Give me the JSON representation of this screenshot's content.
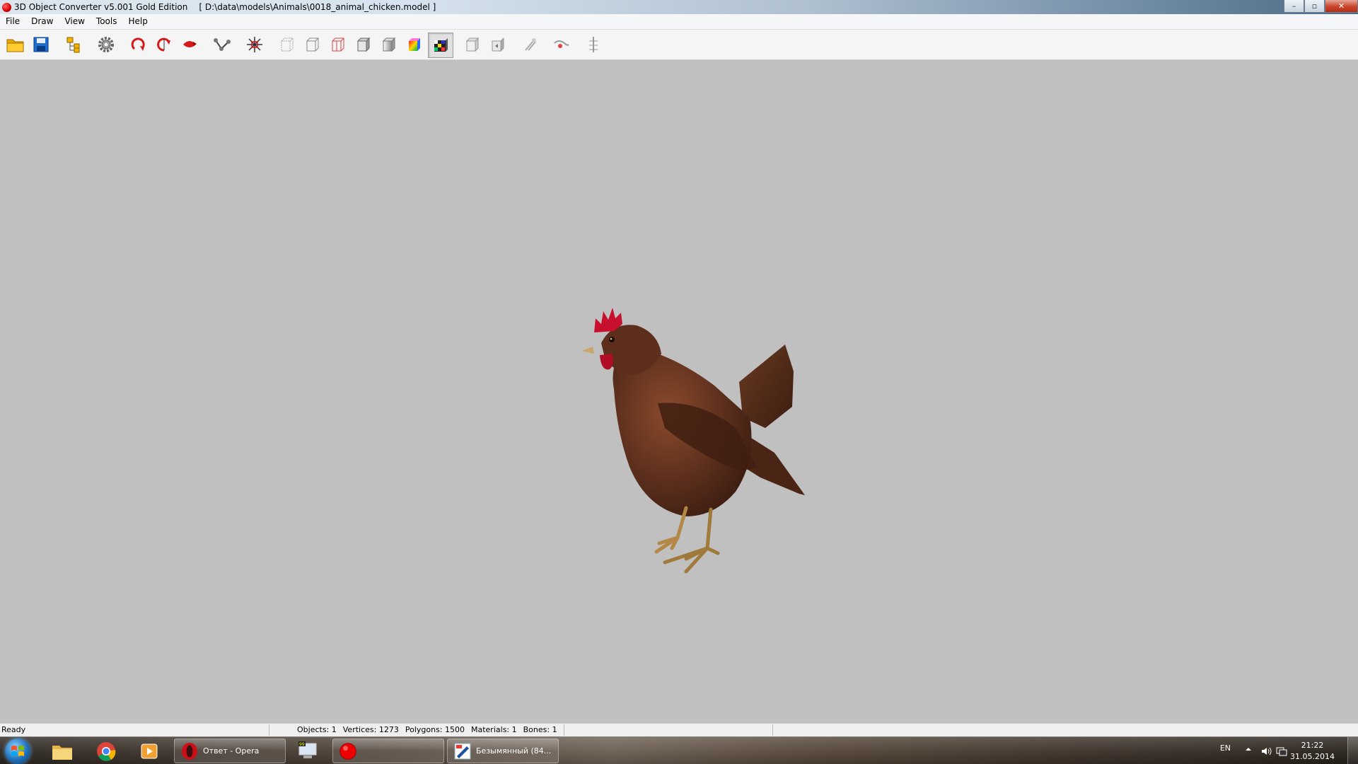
{
  "window": {
    "app_title": "3D Object Converter v5.001 Gold Edition",
    "file_path": "[ D:\\data\\models\\Animals\\0018_animal_chicken.model ]",
    "minimize_symbol": "–",
    "maximize_symbol": "▫",
    "close_symbol": "✕"
  },
  "menu": {
    "items": [
      "File",
      "Draw",
      "View",
      "Tools",
      "Help"
    ]
  },
  "toolbar": {
    "buttons": [
      {
        "icon": "open-folder-icon"
      },
      {
        "icon": "save-disk-icon"
      },
      {
        "icon": "object-tree-icon"
      },
      {
        "icon": "settings-gear-icon"
      },
      {
        "icon": "rotate-x-icon"
      },
      {
        "icon": "rotate-y-icon"
      },
      {
        "icon": "rotate-z-icon"
      },
      {
        "icon": "bones-icon"
      },
      {
        "icon": "scale-icon"
      },
      {
        "icon": "wireframe-icon"
      },
      {
        "icon": "wireframe-box-icon"
      },
      {
        "icon": "wireframe-red-icon"
      },
      {
        "icon": "flat-shading-icon"
      },
      {
        "icon": "smooth-shading-icon"
      },
      {
        "icon": "color-shading-icon"
      },
      {
        "icon": "texture-checker-icon",
        "pressed": true
      },
      {
        "icon": "normals-icon"
      },
      {
        "icon": "backface-icon"
      },
      {
        "icon": "light-icon"
      },
      {
        "icon": "camera-icon"
      },
      {
        "icon": "skeleton-icon"
      }
    ]
  },
  "status": {
    "ready": "Ready",
    "objects": "Objects: 1",
    "vertices": "Vertices: 1273",
    "polygons": "Polygons: 1500",
    "materials": "Materials: 1",
    "bones": "Bones: 1"
  },
  "taskbar": {
    "tasks": [
      {
        "label": "Ответ - Opera",
        "icon": "opera-icon"
      },
      {
        "label": "",
        "icon": "converter-app-icon"
      },
      {
        "label": "Безымянный (84...",
        "icon": "paint-icon"
      }
    ],
    "tray": {
      "language": "EN",
      "time": "21:22",
      "date": "31.05.2014"
    }
  },
  "colors": {
    "viewport_bg": "#c0c0c0",
    "chicken_body": "#5a2e1c",
    "comb": "#c8102e"
  }
}
